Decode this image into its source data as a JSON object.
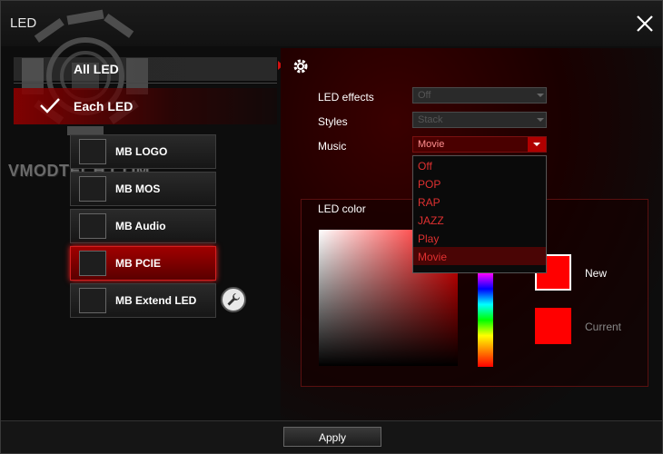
{
  "window": {
    "title": "LED"
  },
  "watermark": "VMODTECH.COM",
  "nav": {
    "all_led": "All LED",
    "each_led": "Each LED"
  },
  "led_items": [
    {
      "label": "MB LOGO",
      "active": false
    },
    {
      "label": "MB MOS",
      "active": false
    },
    {
      "label": "MB Audio",
      "active": false
    },
    {
      "label": "MB PCIE",
      "active": true
    },
    {
      "label": "MB Extend LED",
      "active": false
    }
  ],
  "settings": {
    "led_effects_label": "LED effects",
    "led_effects_value": "Off",
    "styles_label": "Styles",
    "styles_value": "Stack",
    "music_label": "Music",
    "music_value": "Movie"
  },
  "music_options": [
    "Off",
    "POP",
    "RAP",
    "JAZZ",
    "Play",
    "Movie"
  ],
  "music_selected": "Movie",
  "color": {
    "title": "LED color",
    "new_label": "New",
    "current_label": "Current",
    "new_color": "#ff0000",
    "current_color": "#ff0000"
  },
  "apply_label": "Apply",
  "accent": "#d01010"
}
